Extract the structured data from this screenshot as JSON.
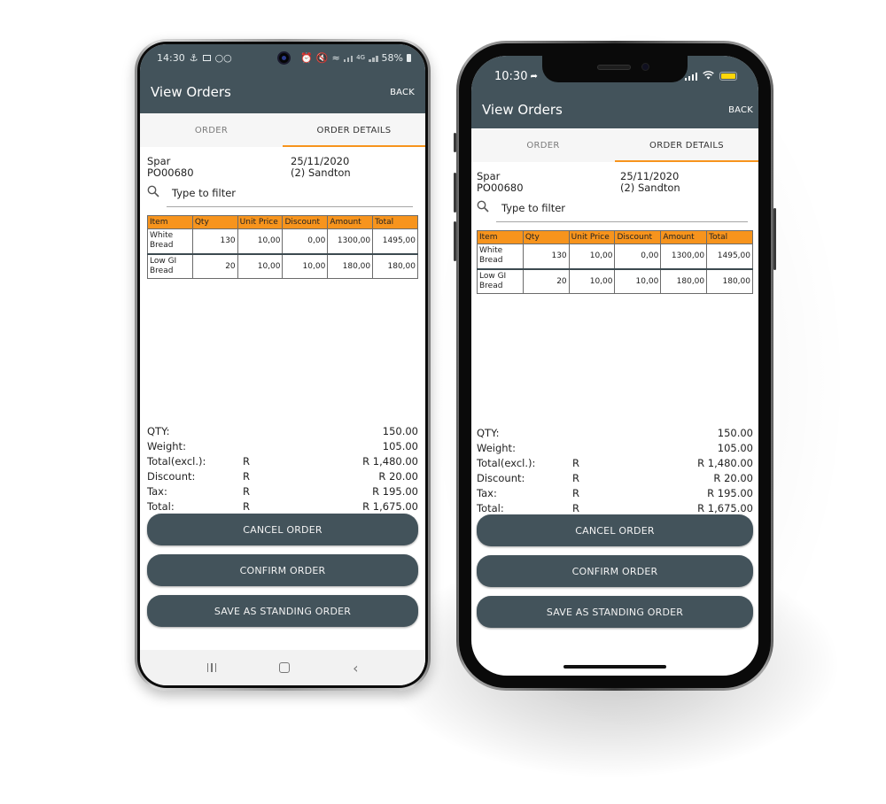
{
  "colors": {
    "primary": "#43535b",
    "accent": "#f7941d",
    "button_text": "#f2f2f2"
  },
  "phones": {
    "android": {
      "status": {
        "time": "14:30",
        "left_icons": [
          "usb-icon",
          "image-icon",
          "incognito-icon"
        ],
        "right_icons": [
          "alarm-icon",
          "mute-icon",
          "wifi-icon",
          "signal-icon",
          "4g-icon",
          "signal-icon"
        ],
        "battery": "58%"
      },
      "navbar": [
        "recent-apps",
        "home",
        "back"
      ]
    },
    "iphone": {
      "status": {
        "time": "10:30",
        "location_arrow": "➶",
        "right_icons": [
          "signal-icon",
          "wifi-icon",
          "battery-icon"
        ]
      }
    }
  },
  "app": {
    "title": "View Orders",
    "back_label": "BACK",
    "tabs": [
      {
        "label": "ORDER",
        "active": false
      },
      {
        "label": "ORDER DETAILS",
        "active": true
      }
    ],
    "order": {
      "customer": "Spar",
      "po_number": "PO00680",
      "date": "25/11/2020",
      "branch": "(2) Sandton"
    },
    "filter": {
      "placeholder": "Type to filter"
    },
    "table": {
      "headers": [
        "Item",
        "Qty",
        "Unit Price",
        "Discount",
        "Amount",
        "Total"
      ],
      "rows": [
        {
          "item": "White Bread",
          "item_line1": "White",
          "item_line2": "Bread",
          "qty": "130",
          "unit_price": "10,00",
          "discount": "0,00",
          "amount": "1300,00",
          "total": "1495,00"
        },
        {
          "item": "Low GI Bread",
          "item_line1": "Low GI",
          "item_line2": "Bread",
          "qty": "20",
          "unit_price": "10,00",
          "discount": "10,00",
          "amount": "180,00",
          "total": "180,00"
        }
      ]
    },
    "summary": [
      {
        "label": "QTY:",
        "currency": "",
        "value": "150.00"
      },
      {
        "label": "Weight:",
        "currency": "",
        "value": "105.00"
      },
      {
        "label": "Total(excl.):",
        "currency": "R",
        "value": "R 1,480.00"
      },
      {
        "label": "Discount:",
        "currency": "R",
        "value": "R 20.00"
      },
      {
        "label": "Tax:",
        "currency": "R",
        "value": "R 195.00"
      },
      {
        "label": "Total:",
        "currency": "R",
        "value": "R 1,675.00"
      }
    ],
    "buttons": {
      "cancel": "CANCEL ORDER",
      "confirm": "CONFIRM ORDER",
      "standing": "SAVE AS STANDING ORDER"
    }
  }
}
